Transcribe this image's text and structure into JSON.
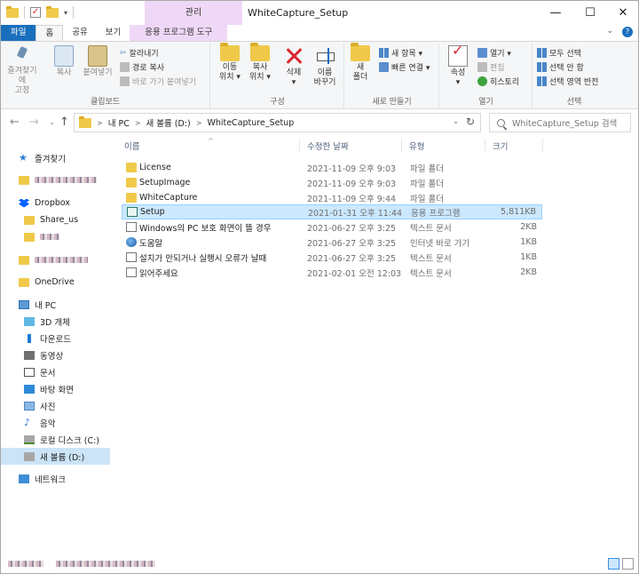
{
  "window": {
    "context_tab_header": "관리",
    "title": "WhiteCapture_Setup",
    "min_glyph": "—",
    "max_glyph": "☐",
    "close_glyph": "✕"
  },
  "ribbon_tabs": {
    "file": "파일",
    "home": "홈",
    "share": "공유",
    "view": "보기",
    "app_tools": "응용 프로그램 도구",
    "collapse_glyph": "⌄",
    "help_glyph": "?"
  },
  "ribbon": {
    "clipboard": {
      "label": "클립보드",
      "pin": "즐겨찾기에\n고정",
      "copy": "복사",
      "paste": "붙여넣기",
      "cut": "잘라내기",
      "copy_path": "경로 복사",
      "paste_shortcut": "바로 가기 붙여넣기"
    },
    "organize": {
      "label": "구성",
      "move_to": "이동\n위치 ▾",
      "copy_to": "복사\n위치 ▾",
      "delete": "삭제\n▾",
      "rename": "이름\n바꾸기"
    },
    "new": {
      "label": "새로 만들기",
      "new_folder": "새\n폴더",
      "new_item": "새 항목 ▾",
      "easy_access": "빠른 연결 ▾"
    },
    "open": {
      "label": "열기",
      "properties": "속성\n▾",
      "open": "열기 ▾",
      "edit": "편집",
      "history": "히스토리"
    },
    "select": {
      "label": "선택",
      "select_all": "모두 선택",
      "select_none": "선택 안 함",
      "invert": "선택 영역 반전"
    }
  },
  "navbar": {
    "back": "←",
    "forward": "→",
    "recent": "⌄",
    "up": "↑",
    "crumbs": [
      "내 PC",
      "새 볼륨 (D:)",
      "WhiteCapture_Setup"
    ],
    "crumb_sep": ">",
    "search_placeholder": "WhiteCapture_Setup 검색"
  },
  "navpane": {
    "favorites": "즐겨찾기",
    "dropbox": "Dropbox",
    "share_us": "Share_us",
    "onedrive": "OneDrive",
    "this_pc": "내 PC",
    "objects3d": "3D 개체",
    "downloads": "다운로드",
    "videos": "동영상",
    "documents": "문서",
    "desktop": "바탕 화면",
    "pictures": "사진",
    "music": "음악",
    "local_c": "로컬 디스크 (C:)",
    "volume_d": "새 볼륨 (D:)",
    "network": "네트워크"
  },
  "columns": {
    "name": "이름",
    "date": "수정한 날짜",
    "type": "유형",
    "size": "크기"
  },
  "files": [
    {
      "name": "License",
      "date": "2021-11-09 오후 9:03",
      "type": "파일 폴더",
      "size": ""
    },
    {
      "name": "SetupImage",
      "date": "2021-11-09 오후 9:03",
      "type": "파일 폴더",
      "size": ""
    },
    {
      "name": "WhiteCapture",
      "date": "2021-11-09 오후 9:44",
      "type": "파일 폴더",
      "size": ""
    },
    {
      "name": "Setup",
      "date": "2021-01-31 오후 11:44",
      "type": "응용 프로그램",
      "size": "5,811KB"
    },
    {
      "name": "Windows의 PC 보호 화면이 뜰 경우",
      "date": "2021-06-27 오후 3:25",
      "type": "텍스트 문서",
      "size": "2KB"
    },
    {
      "name": "도움말",
      "date": "2021-06-27 오후 3:25",
      "type": "인터넷 바로 가기",
      "size": "1KB"
    },
    {
      "name": "설치가 안되거나 실행시 오류가 날때",
      "date": "2021-06-27 오후 3:25",
      "type": "텍스트 문서",
      "size": "1KB"
    },
    {
      "name": "읽어주세요",
      "date": "2021-02-01 오전 12:03",
      "type": "텍스트 문서",
      "size": "2KB"
    }
  ]
}
